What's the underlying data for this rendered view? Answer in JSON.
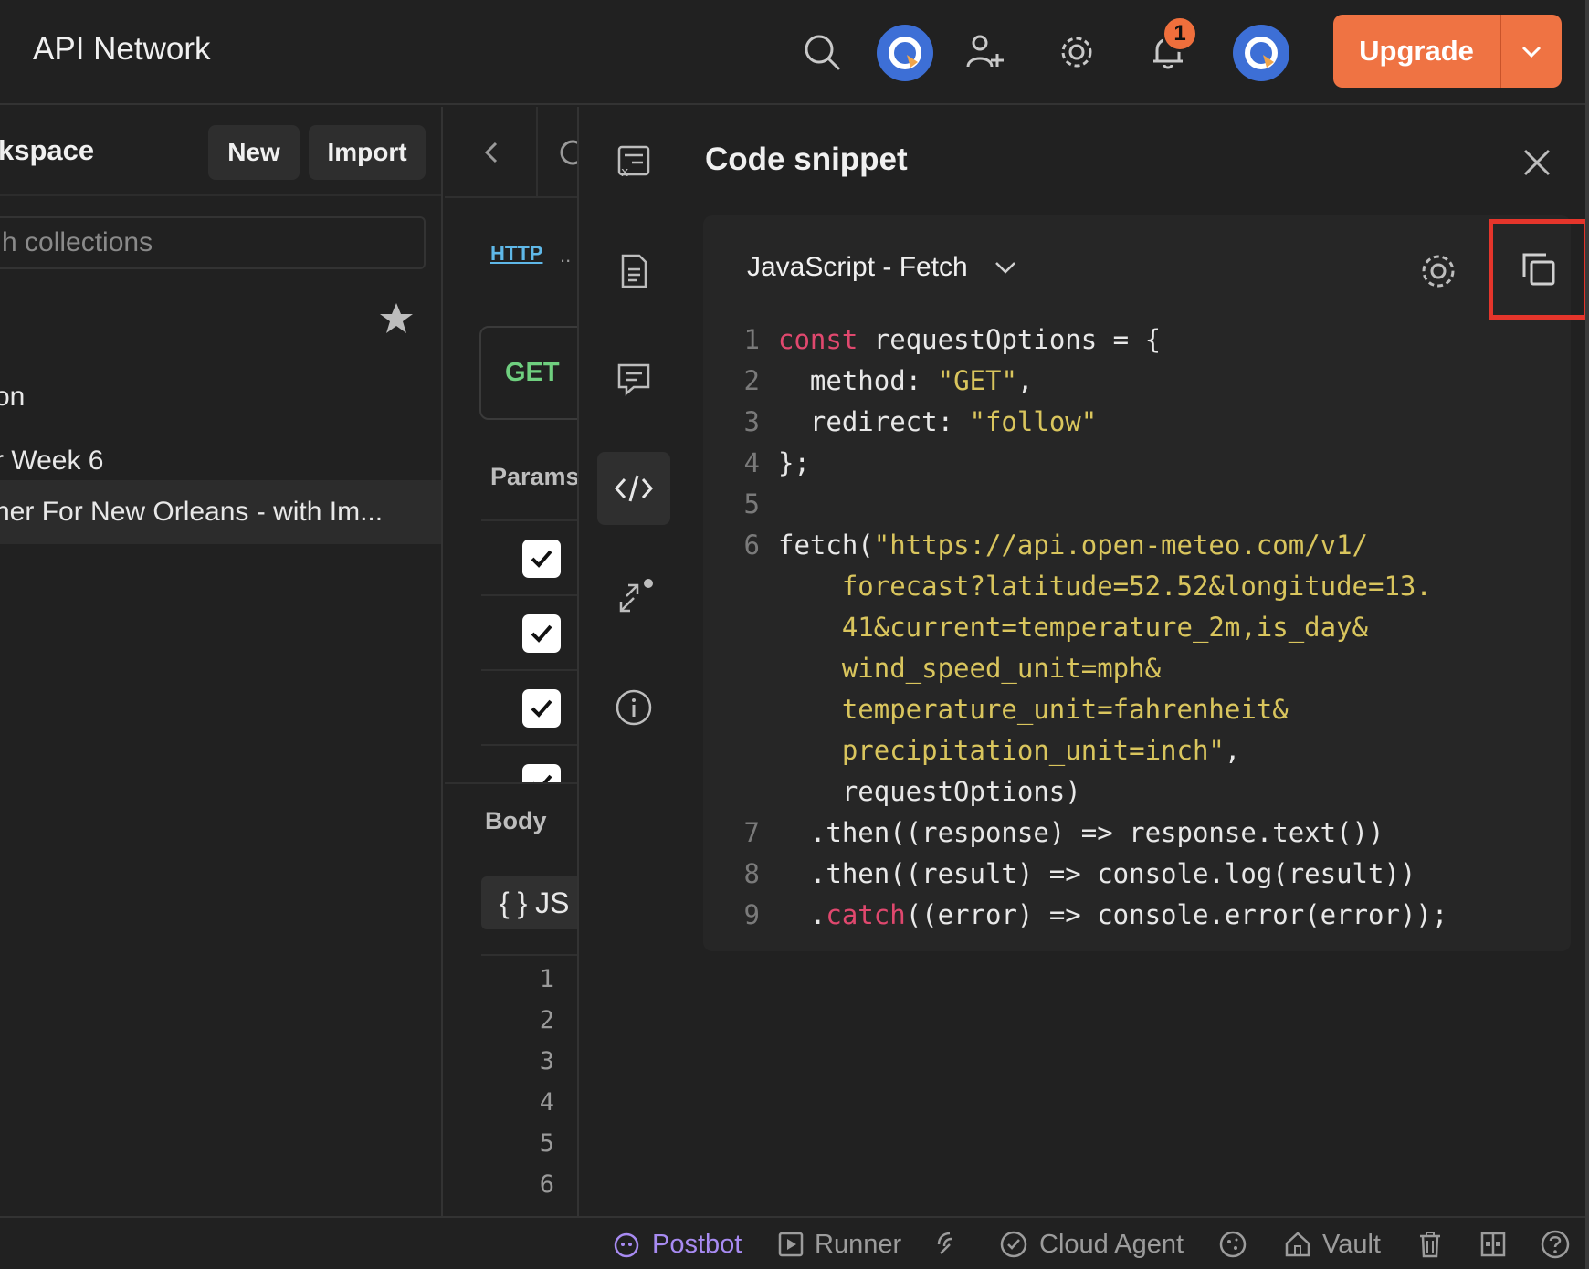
{
  "header": {
    "title": "API Network",
    "notification_count": "1",
    "upgrade_label": "Upgrade"
  },
  "sidebar": {
    "workspace_title": "kspace",
    "new_label": "New",
    "import_label": "Import",
    "search_placeholder": "h collections",
    "items": [
      {
        "label": "on"
      },
      {
        "label": "r Week 6"
      },
      {
        "label": "her For New Orleans - with Im..."
      }
    ]
  },
  "request": {
    "protocol_label": "HTTP",
    "method": "GET",
    "params_label": "Params",
    "body_label": "Body",
    "body_mode": "{ }  JS",
    "body_line_numbers": [
      "1",
      "2",
      "3",
      "4",
      "5",
      "6"
    ]
  },
  "snippet": {
    "title": "Code snippet",
    "language": "JavaScript - Fetch",
    "lines": [
      {
        "n": "1",
        "tokens": [
          {
            "t": "const",
            "c": "kw"
          },
          {
            "t": " requestOptions = {",
            "c": "plain"
          }
        ]
      },
      {
        "n": "2",
        "tokens": [
          {
            "t": "  method: ",
            "c": "plain"
          },
          {
            "t": "\"GET\"",
            "c": "str"
          },
          {
            "t": ",",
            "c": "plain"
          }
        ]
      },
      {
        "n": "3",
        "tokens": [
          {
            "t": "  redirect: ",
            "c": "plain"
          },
          {
            "t": "\"follow\"",
            "c": "str"
          }
        ]
      },
      {
        "n": "4",
        "tokens": [
          {
            "t": "};",
            "c": "plain"
          }
        ]
      },
      {
        "n": "5",
        "tokens": []
      },
      {
        "n": "6",
        "tokens": [
          {
            "t": "fetch(",
            "c": "plain"
          },
          {
            "t": "\"https://api.open-meteo.com/v1/",
            "c": "str"
          }
        ]
      },
      {
        "n": "",
        "tokens": [
          {
            "t": "    forecast?latitude=52.52&longitude=13.",
            "c": "str"
          }
        ]
      },
      {
        "n": "",
        "tokens": [
          {
            "t": "    41&current=temperature_2m,is_day&",
            "c": "str"
          }
        ]
      },
      {
        "n": "",
        "tokens": [
          {
            "t": "    wind_speed_unit=mph&",
            "c": "str"
          }
        ]
      },
      {
        "n": "",
        "tokens": [
          {
            "t": "    temperature_unit=fahrenheit&",
            "c": "str"
          }
        ]
      },
      {
        "n": "",
        "tokens": [
          {
            "t": "    precipitation_unit=inch\"",
            "c": "str"
          },
          {
            "t": ",",
            "c": "plain"
          }
        ]
      },
      {
        "n": "",
        "tokens": [
          {
            "t": "    requestOptions)",
            "c": "plain"
          }
        ]
      },
      {
        "n": "7",
        "tokens": [
          {
            "t": "  .then((response) => response.text())",
            "c": "plain"
          }
        ]
      },
      {
        "n": "8",
        "tokens": [
          {
            "t": "  .then((result) => console.log(result))",
            "c": "plain"
          }
        ]
      },
      {
        "n": "9",
        "tokens": [
          {
            "t": "  .",
            "c": "plain"
          },
          {
            "t": "catch",
            "c": "kw"
          },
          {
            "t": "((error) => console.error(error));",
            "c": "plain"
          }
        ]
      }
    ]
  },
  "footer": {
    "postbot": "Postbot",
    "runner": "Runner",
    "cloud_agent": "Cloud Agent",
    "vault": "Vault"
  },
  "colors": {
    "accent": "#ef7343",
    "highlight_border": "#e5352b",
    "keyword": "#e0486e",
    "string": "#d9c55d",
    "method_get": "#6fcf7f",
    "postbot": "#a88bf2"
  }
}
